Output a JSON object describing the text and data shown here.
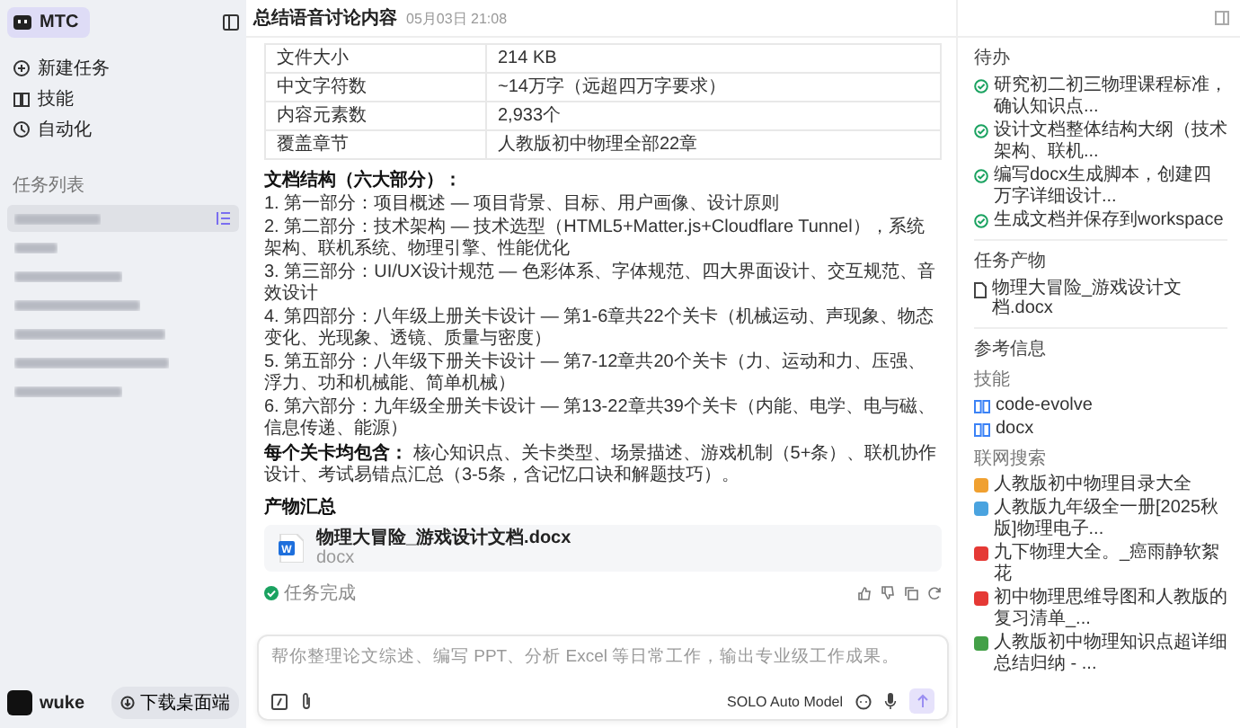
{
  "sidebar": {
    "brand": "MTC",
    "nav": [
      {
        "label": "新建任务",
        "kind": "new"
      },
      {
        "label": "技能",
        "kind": "skills"
      },
      {
        "label": "自动化",
        "kind": "auto"
      }
    ],
    "task_list_title": "任务列表",
    "tasks": [
      {
        "selected": true
      },
      {
        "selected": false
      },
      {
        "selected": false
      },
      {
        "selected": false
      },
      {
        "selected": false
      },
      {
        "selected": false
      },
      {
        "selected": false
      }
    ],
    "user": {
      "name": "wuke"
    },
    "download": "下载桌面端"
  },
  "header": {
    "title": "总结语音讨论内容",
    "time": "05月03日 21:08"
  },
  "table": {
    "rows": [
      {
        "label": "文件大小",
        "value": "214 KB"
      },
      {
        "label": "中文字符数",
        "value": "~14万字（远超四万字要求）"
      },
      {
        "label": "内容元素数",
        "value": "2,933个"
      },
      {
        "label": "覆盖章节",
        "value": "人教版初中物理全部22章"
      }
    ]
  },
  "structure": {
    "title": "文档结构（六大部分）：",
    "items": [
      "1. 第一部分：项目概述 — 项目背景、目标、用户画像、设计原则",
      "2. 第二部分：技术架构 — 技术选型（HTML5+Matter.js+Cloudflare Tunnel），系统架构、联机系统、物理引擎、性能优化",
      "3. 第三部分：UI/UX设计规范 — 色彩体系、字体规范、四大界面设计、交互规范、音效设计",
      "4. 第四部分：八年级上册关卡设计 — 第1-6章共22个关卡（机械运动、声现象、物态变化、光现象、透镜、质量与密度）",
      "5. 第五部分：八年级下册关卡设计 — 第7-12章共20个关卡（力、运动和力、压强、浮力、功和机械能、简单机械）",
      "6. 第六部分：九年级全册关卡设计 — 第13-22章共39个关卡（内能、电学、电与磁、信息传递、能源）"
    ],
    "summary": "**每个关卡均包含：** 核心知识点、关卡类型、场景描述、游戏机制（5+条）、联机协作设计、考试易错点汇总（3-5条，含记忆口诀和解题技巧）。"
  },
  "outputs": {
    "title": "产物汇总",
    "file": {
      "badge": "W",
      "name": "物理大冒险_游戏设计文档.docx",
      "type": "docx"
    }
  },
  "status": {
    "label": "任务完成",
    "done": true
  },
  "composer": {
    "placeholder": "帮你整理论文综述、编写 PPT、分析 Excel 等日常工作，输出专业级工作成果。",
    "model": "SOLO Auto Model"
  },
  "panel": {
    "todo": {
      "title": "待办",
      "items": [
        {
          "label": "研究初二初三物理课程标准，确认知识点...",
          "done": true
        },
        {
          "label": "设计文档整体结构大纲（技术架构、联机...",
          "done": true
        },
        {
          "label": "编写docx生成脚本，创建四万字详细设计...",
          "done": true
        },
        {
          "label": "生成文档并保存到workspace",
          "done": true
        }
      ]
    },
    "artifacts": {
      "title": "任务产物",
      "items": [
        "物理大冒险_游戏设计文档.docx"
      ]
    },
    "references": {
      "title": "参考信息",
      "skills_title": "技能",
      "skills": [
        "code-evolve",
        "docx"
      ],
      "web_title": "联网搜索",
      "web": [
        {
          "label": "人教版初中物理目录大全",
          "color": "#f0a030"
        },
        {
          "label": "人教版九年级全一册[2025秋版]物理电子...",
          "color": "#4aa3df"
        },
        {
          "label": "九下物理大全。_癌雨静软絮花",
          "color": "#e53935"
        },
        {
          "label": "初中物理思维导图和人教版的复习清单_...",
          "color": "#e53935"
        },
        {
          "label": "人教版初中物理知识点超详细总结归纳 - ...",
          "color": "#43a047"
        }
      ]
    }
  }
}
